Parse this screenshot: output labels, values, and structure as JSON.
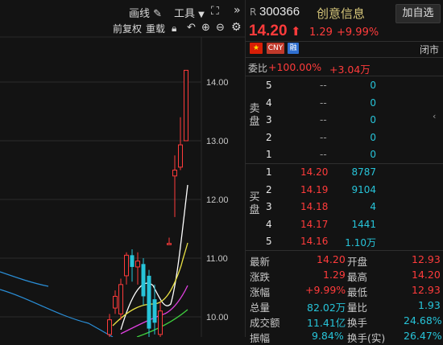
{
  "toolbar": {
    "draw_label": "画线",
    "tools_label": "工具",
    "adjust_label": "前复权",
    "overlay_label": "重载"
  },
  "chart": {
    "price_ticks": [
      "14.00",
      "13.00",
      "12.00",
      "11.00",
      "10.00"
    ],
    "colors": {
      "up": "#ff3b3b",
      "down": "#27c4d9",
      "ma5": "#ffffff",
      "ma10": "#e8e044",
      "ma20": "#e040e0",
      "ma60": "#3fd03f"
    }
  },
  "stock": {
    "market_tag": "R",
    "code": "300366",
    "name": "创意信息",
    "add_watch_label": "加自选",
    "price": "14.20",
    "change": "1.29",
    "change_pct": "+9.99%",
    "status": "闭市",
    "flag_cny": "CNY",
    "flag_margin": "融"
  },
  "orderbook": {
    "ratio_label": "委比",
    "ratio_value": "+100.00%",
    "ratio_diff": "+3.04万",
    "sell_label": "卖盘",
    "buy_label": "买盘",
    "sell": [
      {
        "level": "5",
        "price": "--",
        "vol": "0"
      },
      {
        "level": "4",
        "price": "--",
        "vol": "0"
      },
      {
        "level": "3",
        "price": "--",
        "vol": "0"
      },
      {
        "level": "2",
        "price": "--",
        "vol": "0"
      },
      {
        "level": "1",
        "price": "--",
        "vol": "0"
      }
    ],
    "buy": [
      {
        "level": "1",
        "price": "14.20",
        "vol": "8787"
      },
      {
        "level": "2",
        "price": "14.19",
        "vol": "9104"
      },
      {
        "level": "3",
        "price": "14.18",
        "vol": "4"
      },
      {
        "level": "4",
        "price": "14.17",
        "vol": "1441"
      },
      {
        "level": "5",
        "price": "14.16",
        "vol": "1.10万"
      }
    ]
  },
  "stats": {
    "latest_label": "最新",
    "latest": "14.20",
    "open_label": "开盘",
    "open": "12.93",
    "change_label": "涨跌",
    "change": "1.29",
    "high_label": "最高",
    "high": "14.20",
    "pct_label": "涨幅",
    "pct": "+9.99%",
    "low_label": "最低",
    "low": "12.93",
    "volume_label": "总量",
    "volume": "82.02万",
    "vol_ratio_label": "量比",
    "vol_ratio": "1.93",
    "amount_label": "成交额",
    "amount": "11.41亿",
    "turnover_label": "换手",
    "turnover": "24.68%",
    "amplitude_label": "振幅",
    "amplitude": "9.84%",
    "turnover_real_label": "换手(实)",
    "turnover_real": "26.47%"
  }
}
